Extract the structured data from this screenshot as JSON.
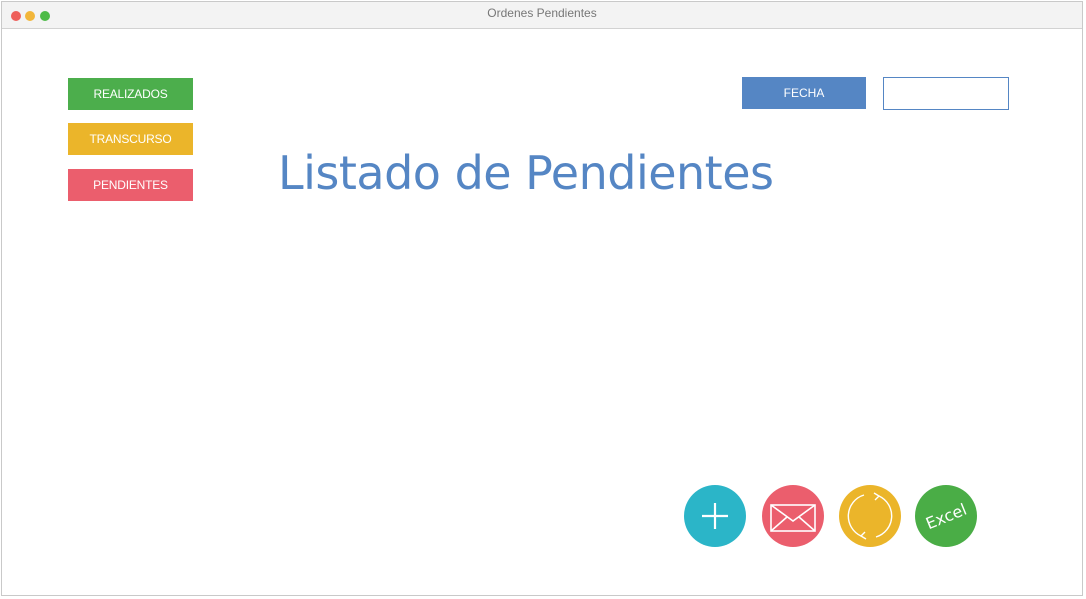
{
  "window": {
    "title": "Ordenes Pendientes"
  },
  "sidebar": {
    "items": [
      {
        "label": "REALIZADOS",
        "color": "#4cae4c"
      },
      {
        "label": "TRANSCURSO",
        "color": "#ebb52a"
      },
      {
        "label": "PENDIENTES",
        "color": "#eb5e6d"
      }
    ]
  },
  "filter": {
    "date_button_label": "FECHA",
    "date_button_color": "#5586c4",
    "date_input_value": "",
    "date_input_border": "#5586c4"
  },
  "main": {
    "title": "Listado de Pendientes",
    "title_color": "#5586c4"
  },
  "actions": [
    {
      "icon": "plus-icon",
      "color": "#2bb5c8"
    },
    {
      "icon": "envelope-icon",
      "color": "#eb5e6d"
    },
    {
      "icon": "refresh-icon",
      "color": "#ebb52a"
    },
    {
      "icon": "excel-label",
      "label": "Excel",
      "color": "#4aad46"
    }
  ],
  "traffic_lights": [
    "#ee5f5a",
    "#f2b63a",
    "#4dbb47"
  ]
}
